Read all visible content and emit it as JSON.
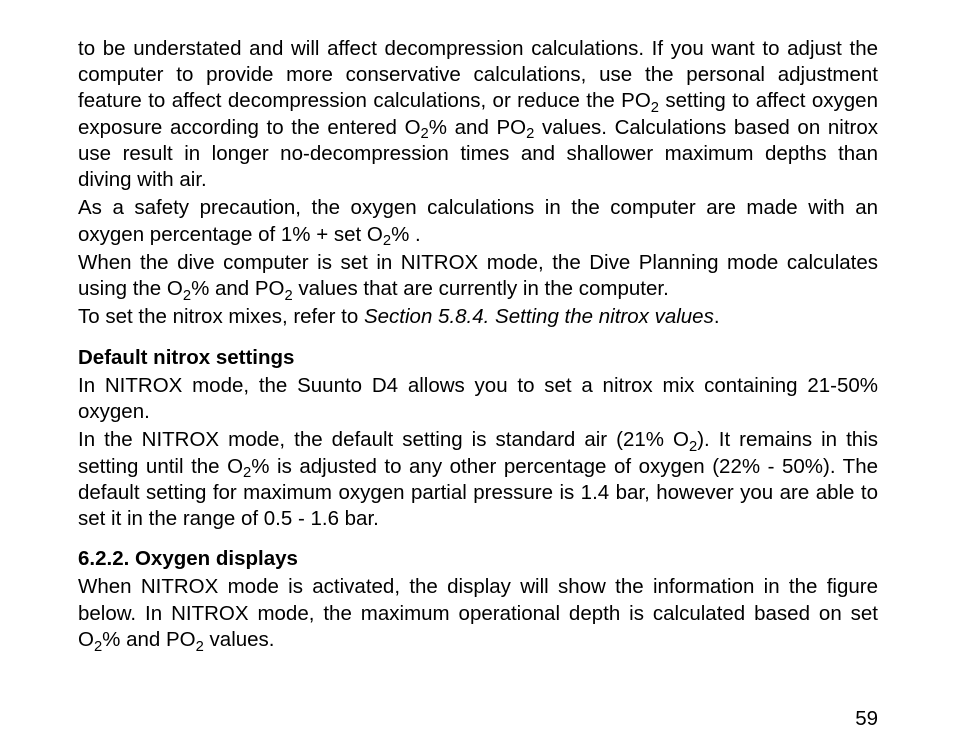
{
  "body": {
    "p1_part1": "to be understated and will affect decompression calculations. If you want to adjust the computer to provide more conservative calculations, use the personal adjustment feature to affect decompression calculations, or reduce the PO",
    "p1_part2": " setting to affect oxygen exposure according to the entered O",
    "p1_part3": "% and PO",
    "p1_part4": " values. Calculations based on nitrox use result in longer no-decompression times and shallower maximum depths than diving with air.",
    "p2_part1": "As a safety precaution, the oxygen calculations in the computer are made with an oxygen percentage of 1% + set O",
    "p2_part2": "% .",
    "p3_part1": "When the dive computer is set in NITROX mode, the Dive Planning mode calculates using the O",
    "p3_part2": "% and PO",
    "p3_part3": " values that are currently in the computer.",
    "p4_part1": "To set the nitrox mixes, refer to ",
    "p4_italic": "Section 5.8.4. Setting the nitrox values",
    "p4_part2": "."
  },
  "section_default": {
    "heading": "Default nitrox settings",
    "p1": "In NITROX mode, the Suunto D4 allows you to set a nitrox mix containing 21-50% oxygen.",
    "p2_part1": "In the NITROX mode, the default setting is standard air (21% O",
    "p2_part2": "). It remains in this setting until the O",
    "p2_part3": "% is adjusted to any other percentage of oxygen (22% - 50%). The default setting for maximum oxygen partial pressure is 1.4 bar, however you are able to set it in the range of 0.5 - 1.6 bar."
  },
  "section_oxygen": {
    "heading": "6.2.2. Oxygen displays",
    "p1_part1": "When NITROX mode is activated, the display will show the information in the figure below. In NITROX mode, the maximum operational depth is calculated based on set O",
    "p1_part2": "% and PO",
    "p1_part3": " values."
  },
  "sub2": "2",
  "page_number": "59"
}
